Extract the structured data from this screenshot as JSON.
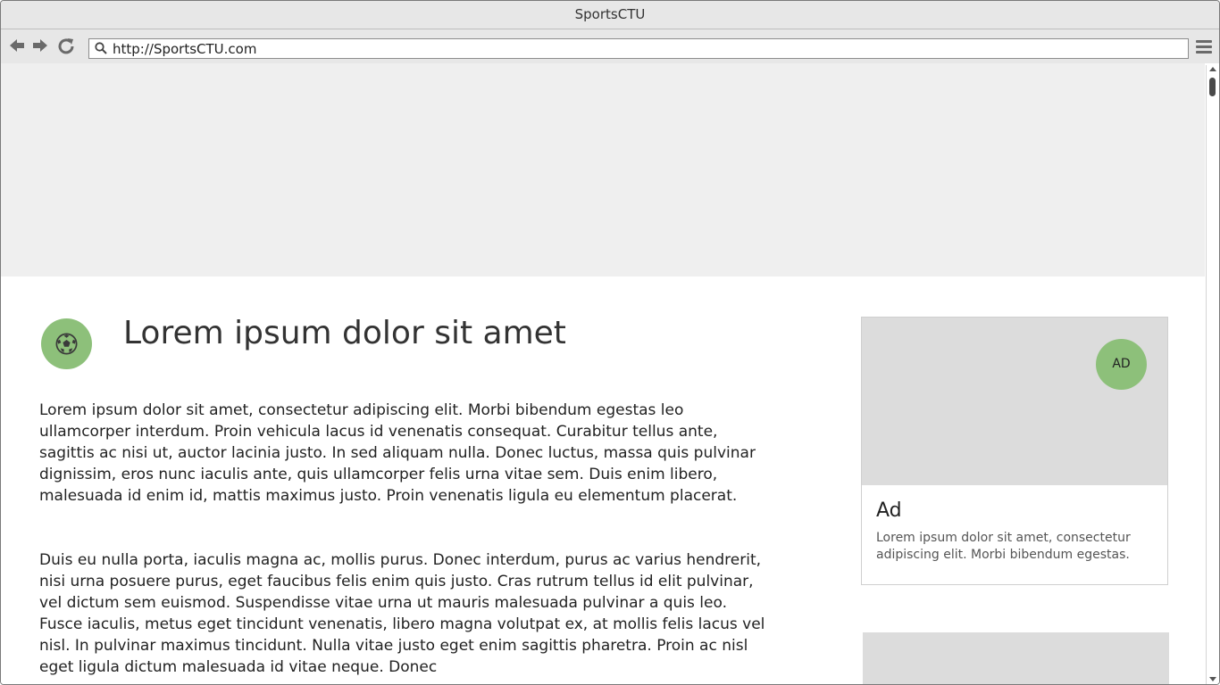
{
  "browser": {
    "title": "SportsCTU",
    "url": "http://SportsCTU.com"
  },
  "article": {
    "icon": "soccer-ball-icon",
    "title": "Lorem ipsum dolor sit amet",
    "paragraphs": [
      "Lorem ipsum dolor sit amet, consectetur adipiscing elit. Morbi bibendum egestas leo ullamcorper interdum. Proin vehicula lacus id venenatis consequat. Curabitur tellus ante, sagittis ac nisi ut, auctor lacinia justo. In sed aliquam nulla. Donec luctus, massa quis pulvinar dignissim, eros nunc iaculis ante, quis ullamcorper felis urna vitae sem. Duis enim libero, malesuada id enim id, mattis maximus justo. Proin venenatis ligula eu elementum placerat.",
      "Duis eu nulla porta, iaculis magna ac, mollis purus. Donec interdum, purus ac varius hendrerit, nisi urna posuere purus, eget faucibus felis enim quis justo. Cras rutrum tellus id elit pulvinar, vel dictum sem euismod. Suspendisse vitae urna ut mauris malesuada pulvinar a quis leo. Fusce iaculis, metus eget tincidunt venenatis, libero magna volutpat ex, at mollis felis lacus vel nisl. In pulvinar maximus tincidunt. Nulla vitae justo eget enim sagittis pharetra. Proin ac nisl eget ligula dictum malesuada id vitae neque. Donec"
    ]
  },
  "sidebar": {
    "ad": {
      "badge": "AD",
      "title": "Ad",
      "text": "Lorem ipsum dolor sit amet, consectetur adipiscing elit. Morbi bibendum egestas."
    }
  },
  "colors": {
    "accent": "#8dc07a",
    "banner": "#efefef",
    "ad_image": "#dcdcdc"
  }
}
